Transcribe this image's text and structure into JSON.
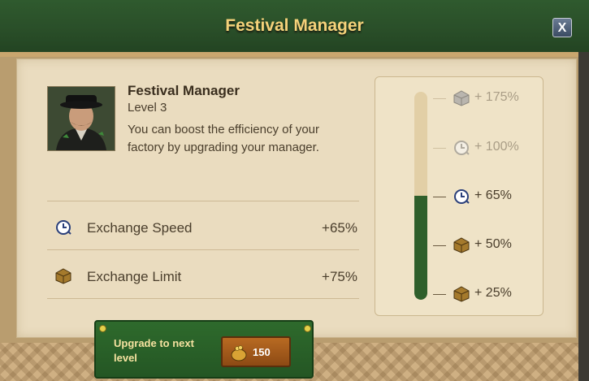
{
  "window": {
    "title": "Festival Manager",
    "close_label": "X"
  },
  "manager": {
    "name": "Festival Manager",
    "level": "Level 3",
    "description": "You can boost the efficiency of your factory by upgrading your manager."
  },
  "stats": [
    {
      "icon": "clock-icon",
      "label": "Exchange Speed",
      "value": "+65%"
    },
    {
      "icon": "crate-icon",
      "label": "Exchange Limit",
      "value": "+75%"
    }
  ],
  "gauge": {
    "progress_fraction": 0.5,
    "levels": [
      {
        "icon": "crate-icon",
        "label": "+ 175%",
        "reached": false
      },
      {
        "icon": "clock-icon",
        "label": "+ 100%",
        "reached": false
      },
      {
        "icon": "clock-icon",
        "label": "+ 65%",
        "reached": true
      },
      {
        "icon": "crate-icon",
        "label": "+ 50%",
        "reached": true
      },
      {
        "icon": "crate-icon",
        "label": "+ 25%",
        "reached": true
      }
    ]
  },
  "upgrade": {
    "label": "Upgrade to next level",
    "cost": "150",
    "cost_icon": "coin-sack-icon"
  },
  "colors": {
    "header_green": "#2f5a2e",
    "title_gold": "#f4d27a",
    "gauge_fill": "#2f5f2b",
    "button_orange": "#b86a22"
  }
}
